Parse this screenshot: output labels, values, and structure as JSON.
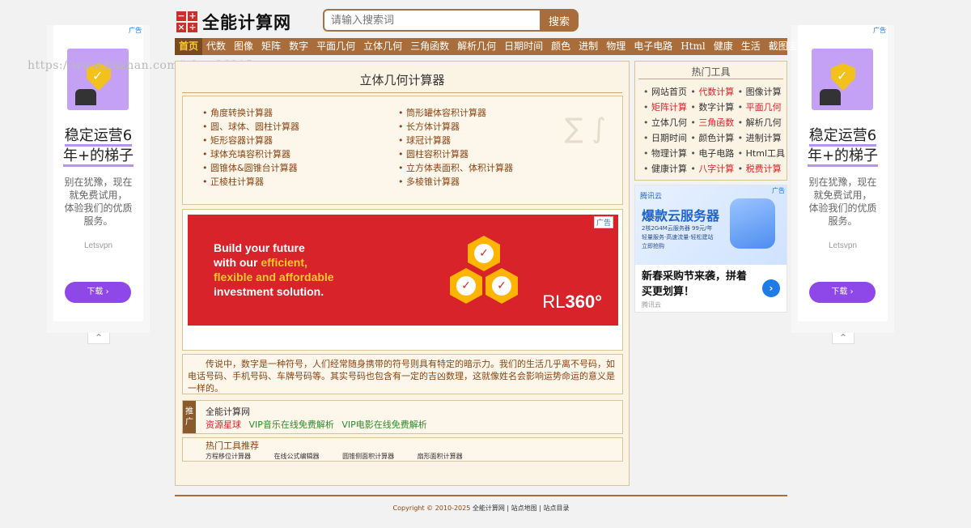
{
  "header": {
    "logo_text": "全能计算网",
    "logo_glyphs": [
      "−",
      "+",
      "×",
      "÷"
    ],
    "search": {
      "placeholder": "请输入搜索词",
      "button": "搜索"
    }
  },
  "nav": [
    "首页",
    "代数",
    "图像",
    "矩阵",
    "数字",
    "平面几何",
    "立体几何",
    "三角函数",
    "解析几何",
    "日期时间",
    "颜色",
    "进制",
    "物理",
    "电子电路",
    "Html",
    "健康",
    "生活",
    "截图宝"
  ],
  "watermark": "https://www.huzhan.com/ishop36315",
  "main": {
    "title": "立体几何计算器",
    "calc_left": [
      "角度转换计算器",
      "圆、球体、圆柱计算器",
      "矩形容器计算器",
      "球体充填容积计算器",
      "圆锥体&圆锥台计算器",
      "正棱柱计算器"
    ],
    "calc_right": [
      "筒形罐体容积计算器",
      "长方体计算器",
      "球冠计算器",
      "圆柱容积计算器",
      "立方体表面积、体积计算器",
      "多棱锥计算器"
    ],
    "ad": {
      "mark": "广告",
      "line1": "Build your future",
      "line2_a": "with our ",
      "line2_b": "efficient,",
      "line3": "flexible and affordable",
      "line4": "investment solution.",
      "brand_a": "RL",
      "brand_b": "360°"
    },
    "description": "传说中，数字是一种符号，人们经常随身携带的符号则具有特定的暗示力。我们的生活几乎离不号码，如电话号码、手机号码、车牌号码等。其实号码也包含有一定的吉凶数理，这就像姓名会影响运势命运的意义是一样的。",
    "promo": {
      "tag": "推广",
      "title": "全能计算网",
      "links": [
        "资源星球",
        "VIP音乐在线免费解析",
        "VIP电影在线免费解析"
      ]
    },
    "hot": {
      "title": "热门工具推荐",
      "links": [
        "方程移位计算器",
        "在线公式编辑器",
        "圆锥侧面积计算器",
        "扇形面积计算器"
      ]
    }
  },
  "sidebar": {
    "title": "热门工具",
    "tools": [
      {
        "label": "网站首页",
        "red": false
      },
      {
        "label": "代数计算",
        "red": true
      },
      {
        "label": "图像计算",
        "red": false
      },
      {
        "label": "矩阵计算",
        "red": true
      },
      {
        "label": "数字计算",
        "red": false
      },
      {
        "label": "平面几何",
        "red": true
      },
      {
        "label": "立体几何",
        "red": false
      },
      {
        "label": "三角函数",
        "red": true
      },
      {
        "label": "解析几何",
        "red": false
      },
      {
        "label": "日期时间",
        "red": false
      },
      {
        "label": "颜色计算",
        "red": false
      },
      {
        "label": "进制计算",
        "red": false
      },
      {
        "label": "物理计算",
        "red": false
      },
      {
        "label": "电子电路",
        "red": false
      },
      {
        "label": "Html工具",
        "red": false
      },
      {
        "label": "健康计算",
        "red": false
      },
      {
        "label": "八字计算",
        "red": true
      },
      {
        "label": "税费计算",
        "red": true
      }
    ],
    "ad": {
      "mark": "广告",
      "logo": "腾讯云",
      "big": "爆款云服务器",
      "small1": "2核2G4M云服务器 99元/年",
      "small2": "轻量服务·高速流量·轻松建站",
      "small3": "立即抢购",
      "headline": "新春采购节来袭，拼着买更划算！",
      "source": "腾讯云",
      "arrow": "›"
    }
  },
  "float_ad": {
    "mark": "广告",
    "headline_1": "稳定运营6",
    "headline_2": "年+的梯子",
    "body": [
      "别在犹豫，现在",
      "就免费试用，",
      "体验我们的优质",
      "服务。"
    ],
    "brand": "Letsvpn",
    "button": "下载 ›",
    "toggle": "^"
  },
  "footer": {
    "copyright": "Copyright © 2010-2025",
    "site": "全能计算网",
    "links": [
      "站点地图",
      "站点目录"
    ]
  },
  "colors": {
    "brand_brown": "#a86d3b",
    "accent_red": "#d8232a",
    "panel_bg": "#fbf3e4",
    "ad_purple": "#8e47e8"
  }
}
